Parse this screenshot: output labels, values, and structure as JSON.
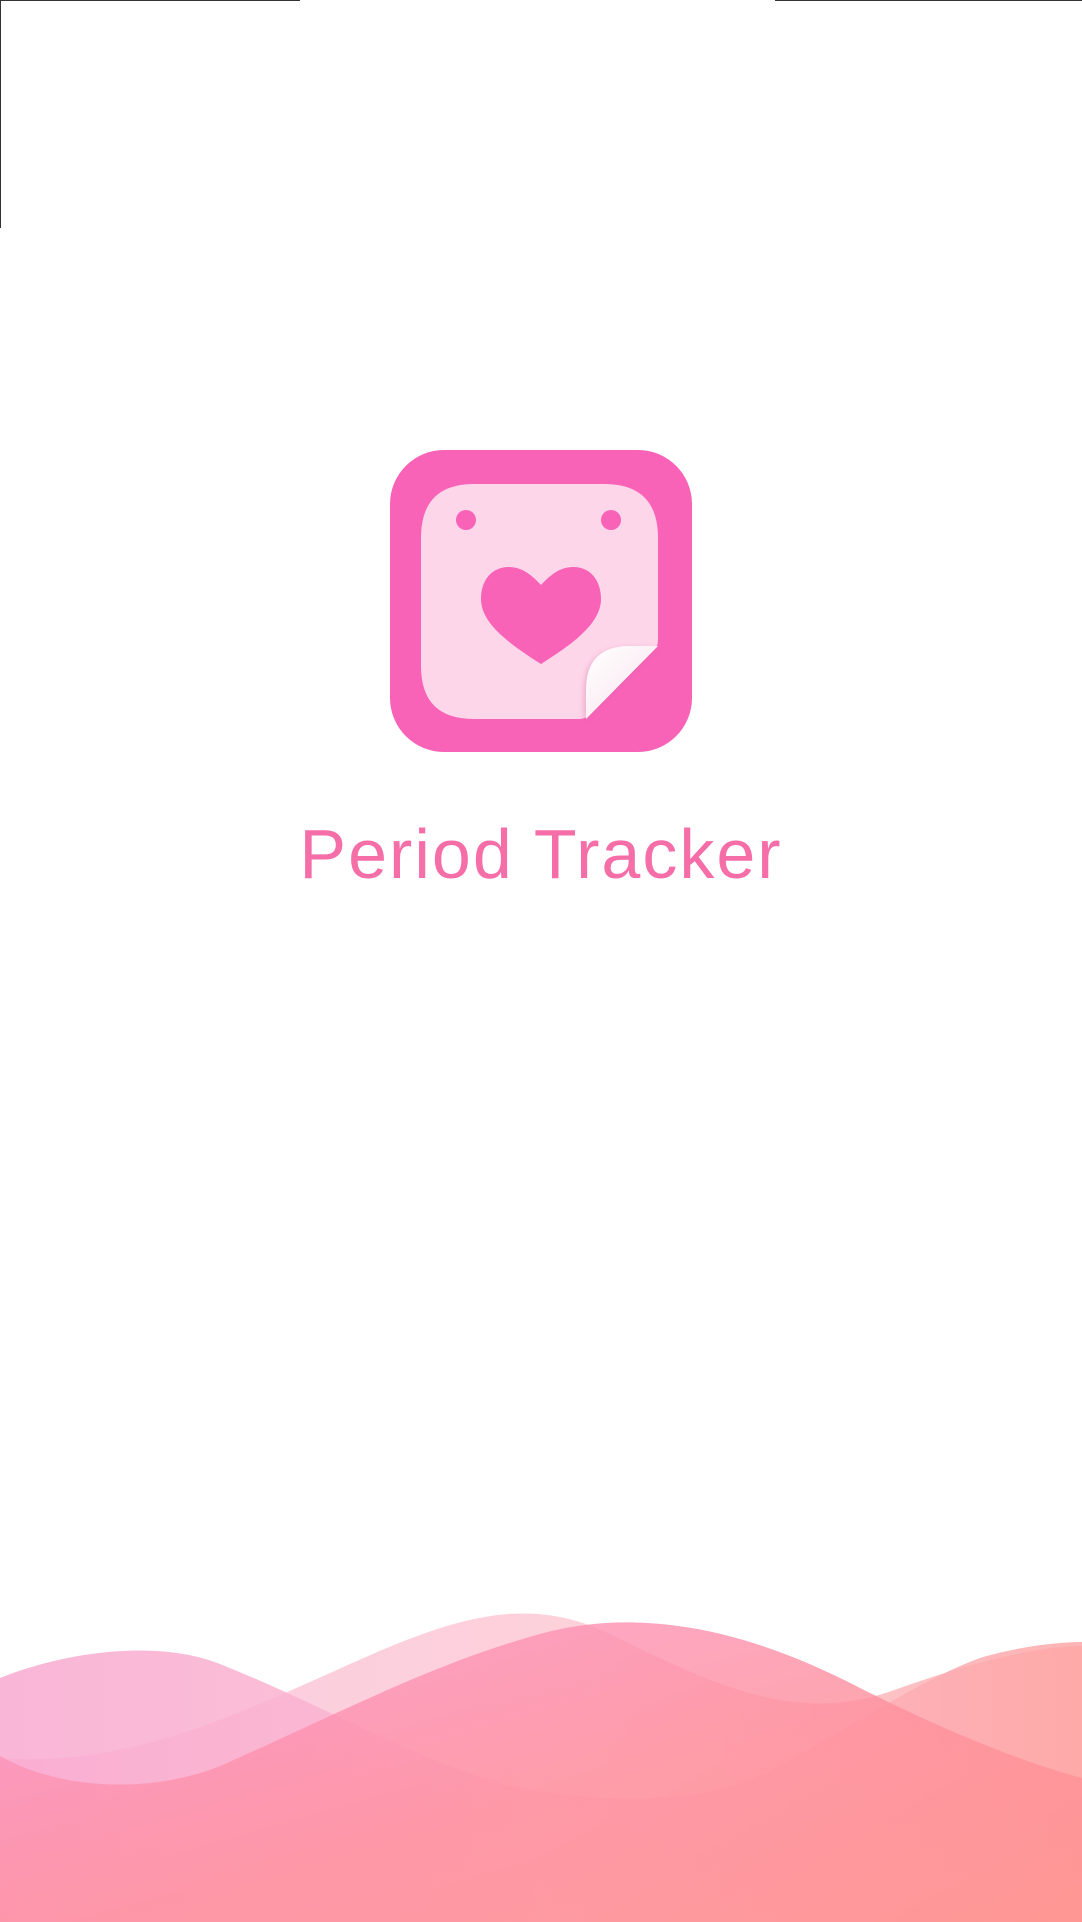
{
  "app": {
    "title": "Period Tracker"
  },
  "icons": {
    "app_icon": "calendar-heart-icon"
  },
  "colors": {
    "brand_pink": "#f863b7",
    "icon_inner": "#fed6ea",
    "title_pink": "#f56ea8",
    "wave_left": "#fc94c9",
    "wave_right": "#ff938f"
  }
}
